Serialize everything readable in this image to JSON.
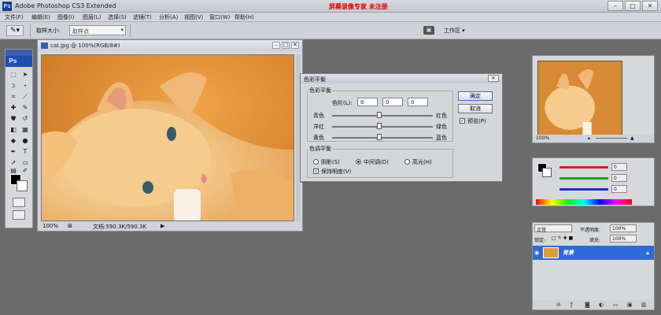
{
  "app": {
    "title": "Adobe Photoshop CS3 Extended",
    "logo_text": "Ps",
    "overlay_text": "屏幕录像专家 未注册"
  },
  "window_controls": {
    "minimize": "–",
    "maximize": "□",
    "close": "✕"
  },
  "menu": [
    "文件(F)",
    "编辑(E)",
    "图像(I)",
    "图层(L)",
    "选择(S)",
    "滤镜(T)",
    "分析(A)",
    "视图(V)",
    "窗口(W)",
    "帮助(H)"
  ],
  "options_bar": {
    "tool_icon": "eyedropper-icon",
    "sample_size_label": "取样大小:",
    "sample_size_value": "取样点",
    "workspace_label": "工作区 ▾"
  },
  "toolbox": {
    "logo": "Ps"
  },
  "document": {
    "title": "cat.jpg @ 100%(RGB/8#)",
    "zoom": "100%",
    "doc_size": "文档:590.3K/590.3K"
  },
  "dialog": {
    "title": "色彩平衡",
    "group_color_balance": "色彩平衡",
    "levels_label": "色阶(L):",
    "levels": [
      "0",
      "0",
      "0"
    ],
    "sliders": [
      {
        "left": "青色",
        "right": "红色",
        "value": 0
      },
      {
        "left": "洋红",
        "right": "绿色",
        "value": 0
      },
      {
        "left": "黄色",
        "right": "蓝色",
        "value": 0
      }
    ],
    "group_tone_balance": "色调平衡",
    "tones": [
      {
        "label": "阴影(S)",
        "selected": false
      },
      {
        "label": "中间调(D)",
        "selected": true
      },
      {
        "label": "高光(H)",
        "selected": false
      }
    ],
    "preserve_luminosity": "保持明度(V)",
    "ok": "确定",
    "cancel": "取消",
    "preview": "预览(P)"
  },
  "navigator": {
    "zoom": "100%"
  },
  "color_panel": {
    "channels": [
      {
        "label": "R",
        "value": "0",
        "color": "#d02020"
      },
      {
        "label": "G",
        "value": "0",
        "color": "#20a020"
      },
      {
        "label": "B",
        "value": "0",
        "color": "#2030c0"
      }
    ]
  },
  "layers": {
    "blend_mode": "正常",
    "opacity_label": "不透明度:",
    "opacity": "100%",
    "lock_label": "锁定:",
    "fill_label": "填充:",
    "fill": "100%",
    "layer_name": "背景"
  },
  "colors": {
    "cat_orange": "#e7a04a",
    "selection_blue": "#2f6bd4",
    "overlay_red": "#e00000"
  }
}
